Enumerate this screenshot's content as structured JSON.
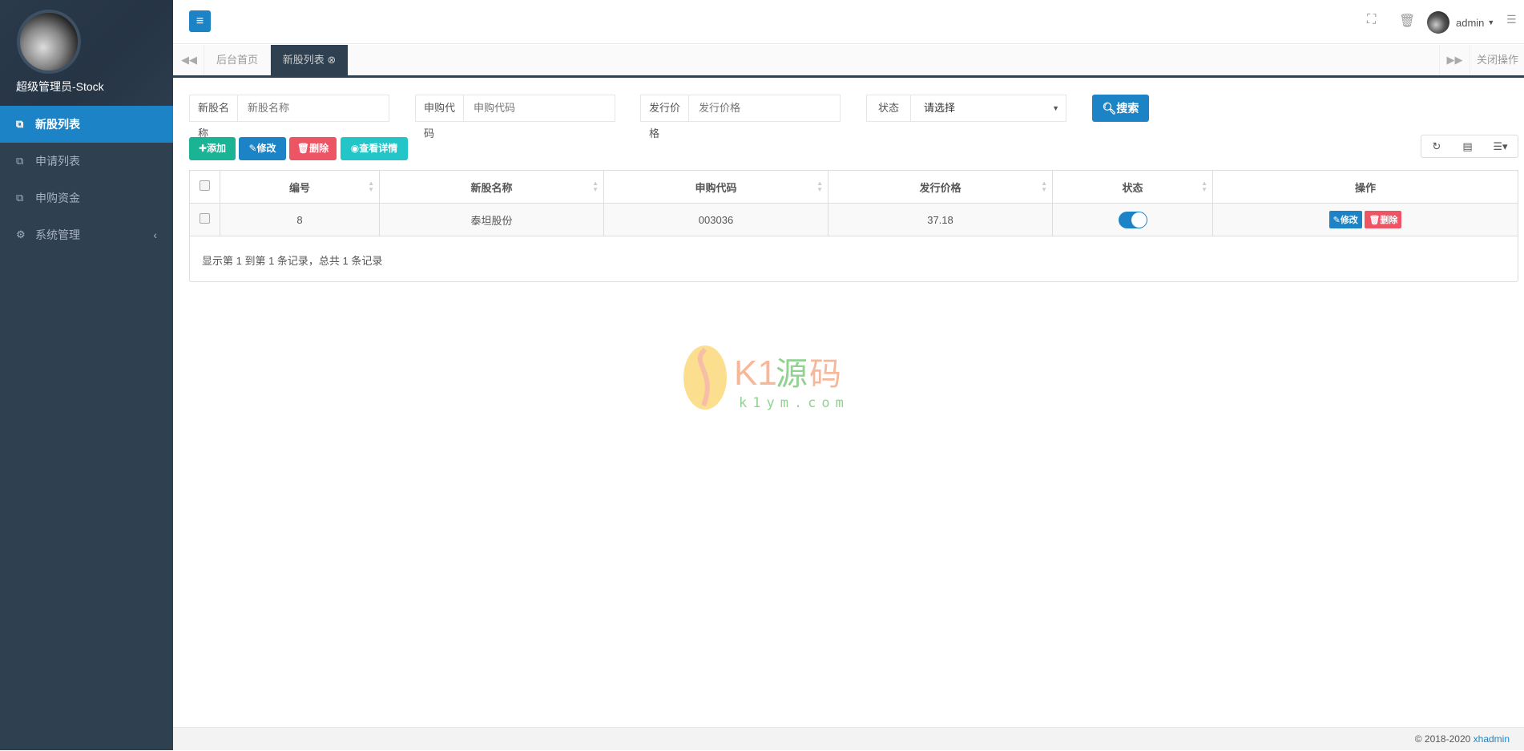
{
  "sidebar": {
    "user_name": "超级管理员-Stock",
    "items": [
      {
        "label": "新股列表",
        "icon": "copy-icon"
      },
      {
        "label": "申请列表",
        "icon": "copy-icon"
      },
      {
        "label": "申购资金",
        "icon": "copy-icon"
      },
      {
        "label": "系统管理",
        "icon": "gears-icon"
      }
    ]
  },
  "header": {
    "user": "admin"
  },
  "tabs": {
    "items": [
      "后台首页",
      "新股列表"
    ],
    "close_ops": "关闭操作"
  },
  "filters": {
    "name_label": "新股名称",
    "name_placeholder": "新股名称",
    "code_label": "申购代码",
    "code_placeholder": "申购代码",
    "price_label": "发行价格",
    "price_placeholder": "发行价格",
    "status_label": "状态",
    "status_value": "请选择",
    "search": "搜索"
  },
  "toolbar": {
    "add": "添加",
    "edit": "修改",
    "delete": "删除",
    "view": "查看详情"
  },
  "table": {
    "headers": [
      "编号",
      "新股名称",
      "申购代码",
      "发行价格",
      "状态",
      "操作"
    ],
    "rows": [
      {
        "id": "8",
        "name": "泰坦股份",
        "code": "003036",
        "price": "37.18",
        "status": true,
        "edit": "修改",
        "delete": "删除"
      }
    ],
    "info": "显示第 1 到第 1 条记录，总共 1 条记录"
  },
  "watermark": {
    "brand": "K1源码",
    "url": "k1ym.com"
  },
  "footer": {
    "copyright": "© 2018-2020",
    "link": "xhadmin"
  },
  "colors": {
    "primary": "#1c84c6",
    "success": "#1ab394",
    "danger": "#ed5565",
    "info": "#23c6c8",
    "sidebar": "#2f4050"
  }
}
